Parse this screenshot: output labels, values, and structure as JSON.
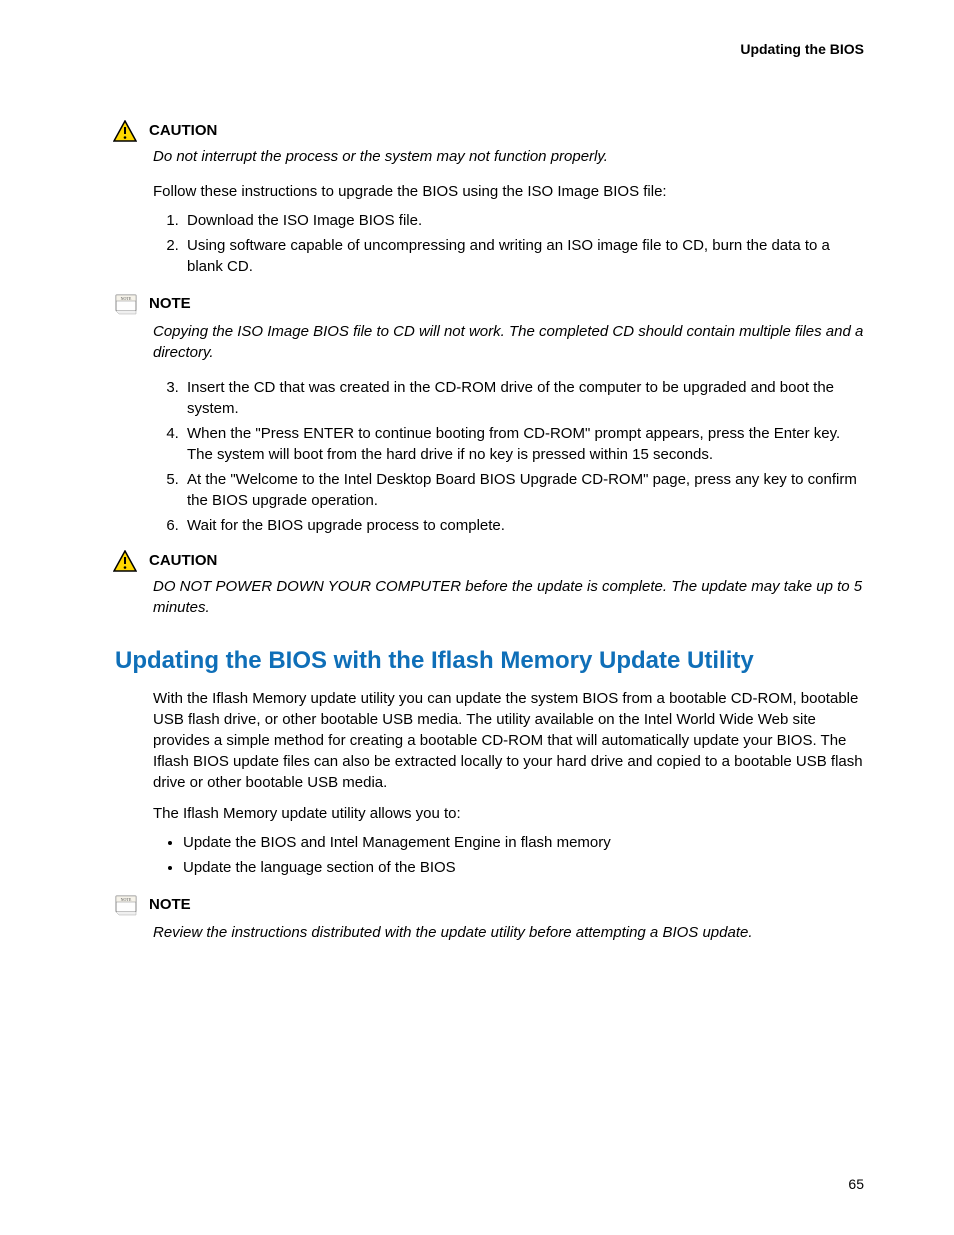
{
  "header": "Updating the BIOS",
  "caution1": {
    "title": "CAUTION",
    "body": "Do not interrupt the process or the system may not function properly."
  },
  "intro_paragraph": "Follow these instructions to upgrade the BIOS using the ISO Image BIOS file:",
  "steps_a": [
    "Download the ISO Image BIOS file.",
    "Using software capable of uncompressing and writing an ISO image file to CD, burn the data to a blank CD."
  ],
  "note1": {
    "title": "NOTE",
    "body": "Copying the ISO Image BIOS file to CD will not work. The completed CD should contain multiple files and a directory."
  },
  "steps_b": [
    "Insert the CD that was created in the CD-ROM drive of the computer to be upgraded and boot the system.",
    "When the \"Press ENTER to continue booting from CD-ROM\" prompt appears, press the Enter key.  The system will boot from the hard drive if no key is pressed within 15 seconds.",
    "At the \"Welcome to the Intel Desktop Board BIOS Upgrade CD-ROM\" page, press any key to confirm the BIOS upgrade operation.",
    "Wait for the BIOS upgrade process to complete."
  ],
  "caution2": {
    "title": "CAUTION",
    "body": "DO NOT POWER DOWN YOUR COMPUTER before the update is complete.  The update may take up to 5 minutes."
  },
  "section_heading": "Updating the BIOS with the Iflash Memory Update Utility",
  "section_p1": "With the Iflash Memory update utility you can update the system BIOS from a bootable CD-ROM, bootable USB flash drive, or other bootable USB media.  The utility available on the Intel World Wide Web site provides a simple method for creating a bootable CD-ROM that will automatically update your BIOS.  The Iflash BIOS update files can also be extracted locally to your hard drive and copied to a bootable USB flash drive or other bootable USB media.",
  "section_p2": "The Iflash Memory update utility allows you to:",
  "bullets": [
    "Update the BIOS and Intel Management Engine in flash memory",
    "Update the language section of the BIOS"
  ],
  "note2": {
    "title": "NOTE",
    "body": "Review the instructions distributed with the update utility before attempting a BIOS update."
  },
  "page_number": "65"
}
